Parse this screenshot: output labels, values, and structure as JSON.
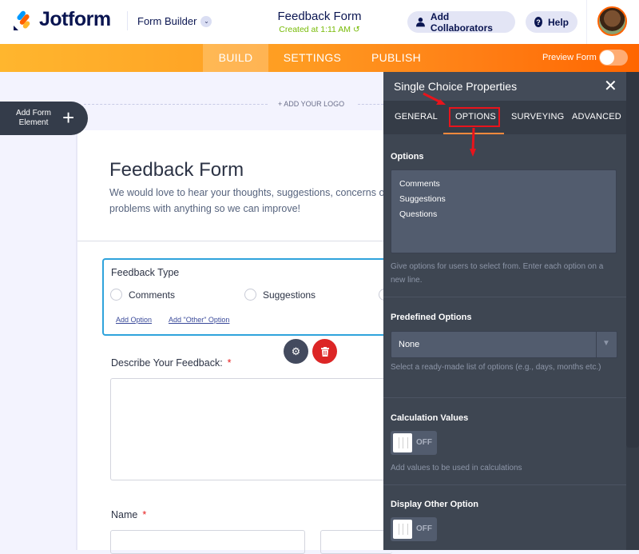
{
  "topbar": {
    "brand": "Jotform",
    "builder_menu": "Form Builder",
    "form_title": "Feedback Form",
    "created": "Created at 1:11 AM",
    "add_collaborators": "Add Collaborators",
    "help": "Help"
  },
  "navbar": {
    "tabs": [
      "BUILD",
      "SETTINGS",
      "PUBLISH"
    ],
    "active_tab": "BUILD",
    "preview_label": "Preview Form",
    "preview_on": false
  },
  "canvas": {
    "add_element": "Add Form Element",
    "add_logo": "+ ADD YOUR LOGO"
  },
  "form": {
    "title": "Feedback Form",
    "subtitle": "We would love to hear your thoughts, suggestions, concerns or problems with anything so we can improve!",
    "question": {
      "label": "Feedback Type",
      "options": [
        "Comments",
        "Suggestions",
        "Questions"
      ],
      "add_option": "Add Option",
      "add_other": "Add \"Other\" Option"
    },
    "describe_label": "Describe Your Feedback:",
    "name_label": "Name",
    "required_mark": "*"
  },
  "panel": {
    "title": "Single Choice Properties",
    "tabs": [
      "GENERAL",
      "OPTIONS",
      "SURVEYING",
      "ADVANCED"
    ],
    "active_tab": "OPTIONS",
    "options_label": "Options",
    "options_values": [
      "Comments",
      "Suggestions",
      "Questions"
    ],
    "options_hint": "Give options for users to select from. Enter each option on a new line.",
    "predefined_label": "Predefined Options",
    "predefined_value": "None",
    "predefined_hint": "Select a ready-made list of options (e.g., days, months etc.)",
    "calc_label": "Calculation Values",
    "calc_state": "OFF",
    "calc_hint": "Add values to be used in calculations",
    "other_label": "Display Other Option",
    "other_state": "OFF"
  },
  "colors": {
    "brand_orange": "#ff6100",
    "annotation_red": "#e8141c",
    "panel_bg": "#3e4652",
    "selection_blue": "#2fa3dc"
  }
}
